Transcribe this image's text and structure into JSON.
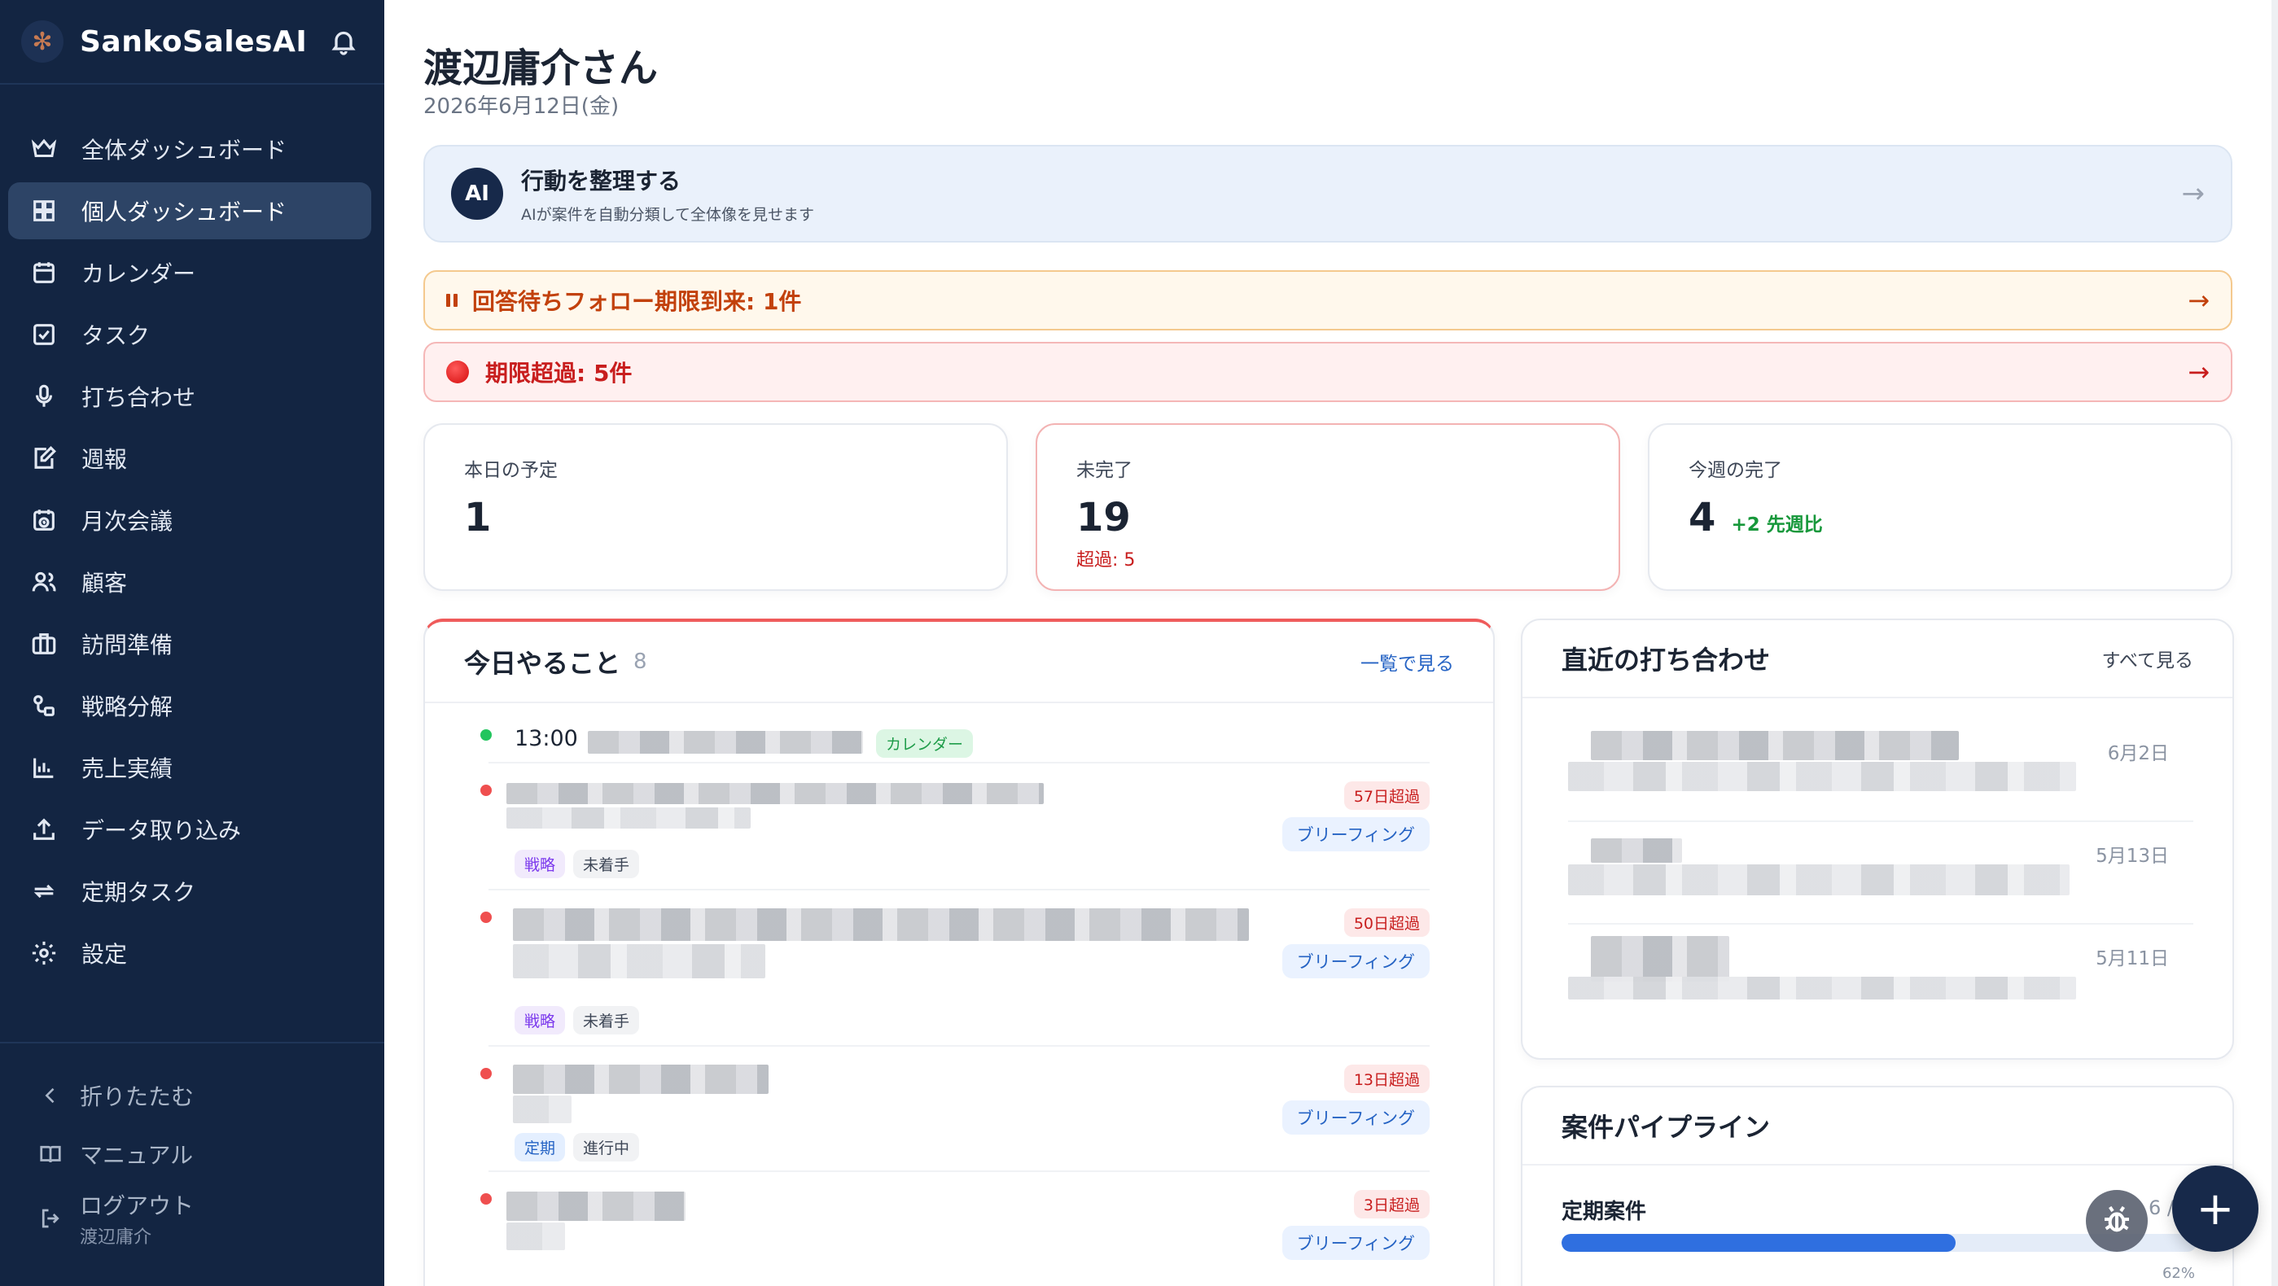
{
  "brand": {
    "name": "SankoSalesAI",
    "logo_icon": "brand-logo-icon"
  },
  "sidebar": {
    "items": [
      {
        "label": "全体ダッシュボード",
        "icon": "crown-icon"
      },
      {
        "label": "個人ダッシュボード",
        "icon": "grid-icon",
        "active": true
      },
      {
        "label": "カレンダー",
        "icon": "calendar-icon"
      },
      {
        "label": "タスク",
        "icon": "check-square-icon"
      },
      {
        "label": "打ち合わせ",
        "icon": "mic-icon"
      },
      {
        "label": "週報",
        "icon": "edit-note-icon"
      },
      {
        "label": "月次会議",
        "icon": "calendar-clock-icon"
      },
      {
        "label": "顧客",
        "icon": "users-icon"
      },
      {
        "label": "訪問準備",
        "icon": "briefcase-icon"
      },
      {
        "label": "戦略分解",
        "icon": "flow-icon"
      },
      {
        "label": "売上実績",
        "icon": "bar-chart-icon"
      },
      {
        "label": "データ取り込み",
        "icon": "upload-icon"
      },
      {
        "label": "定期タスク",
        "icon": "repeat-icon"
      },
      {
        "label": "設定",
        "icon": "gear-icon"
      }
    ],
    "footer": {
      "collapse": "折りたたむ",
      "manual": "マニュアル",
      "logout": "ログアウト",
      "user": "渡辺庸介"
    }
  },
  "header": {
    "greeting": "渡辺庸介さん",
    "date": "2026年6月12日(金)"
  },
  "ai_card": {
    "badge": "AI",
    "title": "行動を整理する",
    "subtitle": "AIが案件を自動分類して全体像を見せます",
    "arrow": "→"
  },
  "alerts": {
    "waiting": {
      "text": "回答待ちフォロー期限到来: 1件",
      "arrow": "→"
    },
    "overdue": {
      "text": "期限超過: 5件",
      "arrow": "→"
    }
  },
  "stats": {
    "today": {
      "label": "本日の予定",
      "value": "1"
    },
    "incomplete": {
      "label": "未完了",
      "value": "19",
      "sub": "超過: 5"
    },
    "week_done": {
      "label": "今週の完了",
      "value": "4",
      "delta": "+2 先週比"
    }
  },
  "today_panel": {
    "title": "今日やること",
    "count": "8",
    "link": "一覧で見る",
    "tasks": [
      {
        "time": "13:00",
        "tag": "カレンダー",
        "dot_color": "#22c55e"
      },
      {
        "overdue": "57日超過",
        "brief": "ブリーフィング",
        "tags": [
          "戦略",
          "未着手"
        ]
      },
      {
        "overdue": "50日超過",
        "brief": "ブリーフィング",
        "tags": [
          "戦略",
          "未着手"
        ]
      },
      {
        "overdue": "13日超過",
        "brief": "ブリーフィング",
        "tags": [
          "定期",
          "進行中"
        ]
      },
      {
        "overdue": "3日超過",
        "brief": "ブリーフィング"
      }
    ]
  },
  "meetings_panel": {
    "title": "直近の打ち合わせ",
    "link": "すべて見る",
    "items": [
      {
        "date": "6月2日"
      },
      {
        "date": "5月13日"
      },
      {
        "date": "5月11日"
      }
    ]
  },
  "pipeline_panel": {
    "title": "案件パイプライン",
    "row_label": "定期案件",
    "count": "6 /",
    "progress": 0.62,
    "percent": "62%"
  },
  "fab": {
    "label": "+"
  },
  "colors": {
    "sidebar": "#132542",
    "accent": "#2563c4",
    "danger": "#c81e1e",
    "success": "#17983b"
  }
}
